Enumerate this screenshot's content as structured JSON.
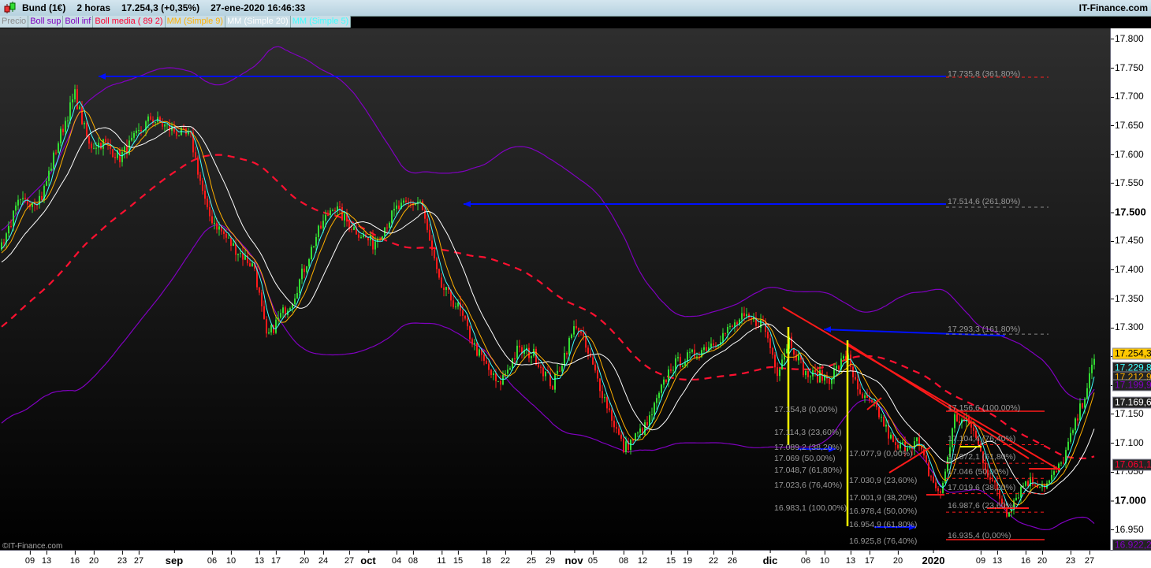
{
  "header": {
    "instrument": "Bund (1€)",
    "interval": "2 horas",
    "price_change": "17.254,3 (+0,35%)",
    "datetime": "27-ene-2020 16:46:33",
    "brand": "IT-Finance.com"
  },
  "legend": [
    {
      "label": "Precio",
      "color": "#8a8a8a"
    },
    {
      "label": "Boll sup",
      "color": "#8000c0"
    },
    {
      "label": "Boll inf",
      "color": "#8000c0"
    },
    {
      "label": "Boll media ( 89 2)",
      "color": "#ff0030"
    },
    {
      "label": "MM (Simple 9)",
      "color": "#ffb000"
    },
    {
      "label": "MM (Simple 20)",
      "color": "#ffffff"
    },
    {
      "label": "MM (Simple 5)",
      "color": "#40ffff"
    }
  ],
  "copyright": "©IT-Finance.com",
  "price_badges": [
    {
      "text": "17.254,3",
      "value": 17.2543,
      "bg": "#ffc800",
      "fg": "#000000"
    },
    {
      "text": "17.229,8",
      "value": 17.2298,
      "bg": "#222222",
      "fg": "#40ffff"
    },
    {
      "text": "17.212,9",
      "value": 17.2129,
      "bg": "#222222",
      "fg": "#ffb000"
    },
    {
      "text": "17.199,9",
      "value": 17.1999,
      "bg": "#222222",
      "fg": "#8000c0"
    },
    {
      "text": "17.169,6",
      "value": 17.1696,
      "bg": "#222222",
      "fg": "#ffffff"
    },
    {
      "text": "17.061,1",
      "value": 17.0611,
      "bg": "#222222",
      "fg": "#ff0030"
    },
    {
      "text": "16.922,2",
      "value": 16.9222,
      "bg": "#222222",
      "fg": "#8000c0"
    }
  ],
  "fib_labels": {
    "projections": [
      {
        "text": "17.735,8 (361,80%)",
        "value": 17.7358
      },
      {
        "text": "17.514,6 (261,80%)",
        "value": 17.5146
      },
      {
        "text": "17.293,3 (161,80%)",
        "value": 17.2933
      }
    ],
    "group1": [
      {
        "text": "17.154,8 (0,00%)",
        "value": 17.1548
      },
      {
        "text": "17.114,3 (23,60%)",
        "value": 17.1143
      },
      {
        "text": "17.089,2 (38,20%)",
        "value": 17.0892
      },
      {
        "text": "17.069 (50,00%)",
        "value": 17.069
      },
      {
        "text": "17.048,7 (61,80%)",
        "value": 17.0487
      },
      {
        "text": "17.023,6 (76,40%)",
        "value": 17.0236
      },
      {
        "text": "16.983,1 (100,00%)",
        "value": 16.9831
      }
    ],
    "group2": [
      {
        "text": "17.077,9 (0,00%)",
        "value": 17.0779
      },
      {
        "text": "17.030,9 (23,60%)",
        "value": 17.0309
      },
      {
        "text": "17.001,9 (38,20%)",
        "value": 17.0019
      },
      {
        "text": "16.978,4 (50,00%)",
        "value": 16.9784
      },
      {
        "text": "16.954,9 (61,80%)",
        "value": 16.9549
      },
      {
        "text": "16.925,8 (76,40%)",
        "value": 16.9258
      }
    ],
    "group3": [
      {
        "text": "17.156,6 (100,00%)",
        "value": 17.1566
      },
      {
        "text": "17.104,4 (76,40%)",
        "value": 17.1044
      },
      {
        "text": "17.072,1 (61,80%)",
        "value": 17.0721
      },
      {
        "text": "17.046 (50,00%)",
        "value": 17.046
      },
      {
        "text": "17.019,6 (38,20%)",
        "value": 17.0196
      },
      {
        "text": "16.987,6 (23,60%)",
        "value": 16.9876
      },
      {
        "text": "16.935,4 (0,00%)",
        "value": 16.9354
      }
    ]
  },
  "chart_data": {
    "type": "line",
    "title": "Bund (1€) 2 horas",
    "xlabel": "",
    "ylabel": "",
    "ylim": [
      16.915,
      17.82
    ],
    "y_ticks": [
      "17.800",
      "17.750",
      "17.700",
      "17.650",
      "17.600",
      "17.550",
      "17.500",
      "17.450",
      "17.400",
      "17.350",
      "17.300",
      "17.250",
      "17.200",
      "17.150",
      "17.100",
      "17.050",
      "17.000",
      "16.950"
    ],
    "y_tick_values": [
      17.8,
      17.75,
      17.7,
      17.65,
      17.6,
      17.55,
      17.5,
      17.45,
      17.4,
      17.35,
      17.3,
      17.25,
      17.2,
      17.15,
      17.1,
      17.05,
      17.0,
      16.95
    ],
    "y_bold": [
      "17.500",
      "17.000"
    ],
    "x_ticks": [
      {
        "label": "09",
        "bar": 12
      },
      {
        "label": "13",
        "bar": 19
      },
      {
        "label": "16",
        "bar": 31
      },
      {
        "label": "20",
        "bar": 39
      },
      {
        "label": "23",
        "bar": 51
      },
      {
        "label": "27",
        "bar": 58
      },
      {
        "label": "sep",
        "bar": 73,
        "bold": true
      },
      {
        "label": "06",
        "bar": 89
      },
      {
        "label": "10",
        "bar": 97
      },
      {
        "label": "13",
        "bar": 109
      },
      {
        "label": "17",
        "bar": 116
      },
      {
        "label": "20",
        "bar": 128
      },
      {
        "label": "24",
        "bar": 136
      },
      {
        "label": "27",
        "bar": 147
      },
      {
        "label": "oct",
        "bar": 155,
        "bold": true
      },
      {
        "label": "04",
        "bar": 167
      },
      {
        "label": "08",
        "bar": 174
      },
      {
        "label": "11",
        "bar": 186
      },
      {
        "label": "15",
        "bar": 193
      },
      {
        "label": "18",
        "bar": 205
      },
      {
        "label": "22",
        "bar": 213
      },
      {
        "label": "25",
        "bar": 224
      },
      {
        "label": "29",
        "bar": 232
      },
      {
        "label": "nov",
        "bar": 242,
        "bold": true
      },
      {
        "label": "05",
        "bar": 250
      },
      {
        "label": "08",
        "bar": 263
      },
      {
        "label": "12",
        "bar": 271
      },
      {
        "label": "15",
        "bar": 283
      },
      {
        "label": "19",
        "bar": 290
      },
      {
        "label": "22",
        "bar": 301
      },
      {
        "label": "26",
        "bar": 309
      },
      {
        "label": "dic",
        "bar": 325,
        "bold": true
      },
      {
        "label": "06",
        "bar": 340
      },
      {
        "label": "10",
        "bar": 348
      },
      {
        "label": "13",
        "bar": 359
      },
      {
        "label": "17",
        "bar": 367
      },
      {
        "label": "20",
        "bar": 379
      },
      {
        "label": "2020",
        "bar": 394,
        "bold": true
      },
      {
        "label": "09",
        "bar": 414
      },
      {
        "label": "13",
        "bar": 421
      },
      {
        "label": "16",
        "bar": 433
      },
      {
        "label": "20",
        "bar": 440
      },
      {
        "label": "23",
        "bar": 452
      },
      {
        "label": "27",
        "bar": 460
      }
    ],
    "close_waypoints": [
      [
        0,
        17.444
      ],
      [
        7,
        17.512
      ],
      [
        17,
        17.526
      ],
      [
        25,
        17.635
      ],
      [
        31,
        17.703
      ],
      [
        37,
        17.614
      ],
      [
        43,
        17.62
      ],
      [
        50,
        17.594
      ],
      [
        63,
        17.662
      ],
      [
        72,
        17.642
      ],
      [
        80,
        17.628
      ],
      [
        87,
        17.498
      ],
      [
        97,
        17.444
      ],
      [
        107,
        17.403
      ],
      [
        112,
        17.28
      ],
      [
        117,
        17.314
      ],
      [
        123,
        17.348
      ],
      [
        133,
        17.457
      ],
      [
        140,
        17.512
      ],
      [
        147,
        17.478
      ],
      [
        157,
        17.444
      ],
      [
        167,
        17.505
      ],
      [
        177,
        17.519
      ],
      [
        185,
        17.375
      ],
      [
        193,
        17.334
      ],
      [
        200,
        17.266
      ],
      [
        210,
        17.198
      ],
      [
        218,
        17.259
      ],
      [
        225,
        17.253
      ],
      [
        233,
        17.198
      ],
      [
        243,
        17.307
      ],
      [
        253,
        17.198
      ],
      [
        263,
        17.089
      ],
      [
        273,
        17.13
      ],
      [
        283,
        17.232
      ],
      [
        293,
        17.253
      ],
      [
        303,
        17.28
      ],
      [
        313,
        17.314
      ],
      [
        322,
        17.307
      ],
      [
        328,
        17.225
      ],
      [
        333,
        17.28
      ],
      [
        340,
        17.218
      ],
      [
        350,
        17.212
      ],
      [
        358,
        17.253
      ],
      [
        362,
        17.184
      ],
      [
        370,
        17.157
      ],
      [
        378,
        17.089
      ],
      [
        387,
        17.102
      ],
      [
        392,
        17.048
      ],
      [
        397,
        17.007
      ],
      [
        403,
        17.143
      ],
      [
        410,
        17.13
      ],
      [
        417,
        17.048
      ],
      [
        425,
        16.98
      ],
      [
        433,
        17.034
      ],
      [
        442,
        17.027
      ],
      [
        448,
        17.061
      ],
      [
        455,
        17.143
      ],
      [
        462,
        17.24
      ]
    ],
    "series": [
      {
        "name": "Precio"
      },
      {
        "name": "Boll sup"
      },
      {
        "name": "Boll inf"
      },
      {
        "name": "Boll media ( 89 2)"
      },
      {
        "name": "MM (Simple 9)"
      },
      {
        "name": "MM (Simple 20)"
      },
      {
        "name": "MM (Simple 5)"
      }
    ]
  }
}
